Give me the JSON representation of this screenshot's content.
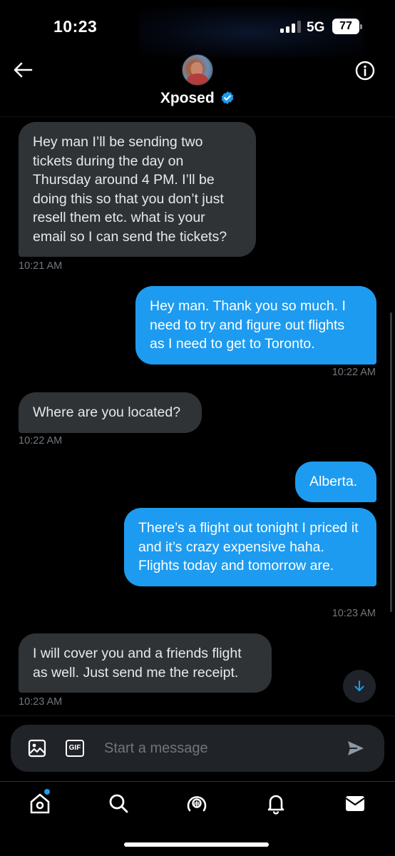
{
  "status_bar": {
    "time": "10:23",
    "network": "5G",
    "battery": "77"
  },
  "header": {
    "contact_name": "Xposed",
    "verified": true,
    "back_icon": "arrow-left-icon",
    "info_icon": "info-circle-icon"
  },
  "messages": [
    {
      "direction": "incoming",
      "text": "Hey man I’ll be sending two tickets during the day on Thursday around 4 PM. I’ll be doing this so that you don’t just resell them etc. what is your email so I can send the tickets?",
      "time": "10:21 AM"
    },
    {
      "direction": "outgoing",
      "text": "Hey man. Thank you so much. I need to try and figure out flights as I need to get to Toronto.",
      "time": "10:22 AM"
    },
    {
      "direction": "incoming",
      "text": "Where are you located?",
      "time": "10:22 AM"
    },
    {
      "direction": "outgoing",
      "text": "Alberta.",
      "time": ""
    },
    {
      "direction": "outgoing",
      "text": "There’s a flight out tonight I priced it and it’s crazy expensive haha. Flights today and tomorrow are.",
      "time": "10:23 AM"
    },
    {
      "direction": "incoming",
      "text": "I will cover you and a friends flight as well. Just send me the receipt.",
      "time": "10:23 AM"
    }
  ],
  "composer": {
    "placeholder": "Start a message",
    "gif_label": "GIF"
  },
  "bottom_nav": [
    {
      "name": "home",
      "icon": "home-icon",
      "badge": true
    },
    {
      "name": "search",
      "icon": "search-icon"
    },
    {
      "name": "spaces",
      "icon": "spaces-icon"
    },
    {
      "name": "notifications",
      "icon": "bell-icon"
    },
    {
      "name": "messages",
      "icon": "mail-icon"
    }
  ],
  "colors": {
    "outgoing_bubble": "#1d9bf0",
    "incoming_bubble": "#2f3336",
    "timestamp": "#71767b",
    "background": "#000000"
  }
}
